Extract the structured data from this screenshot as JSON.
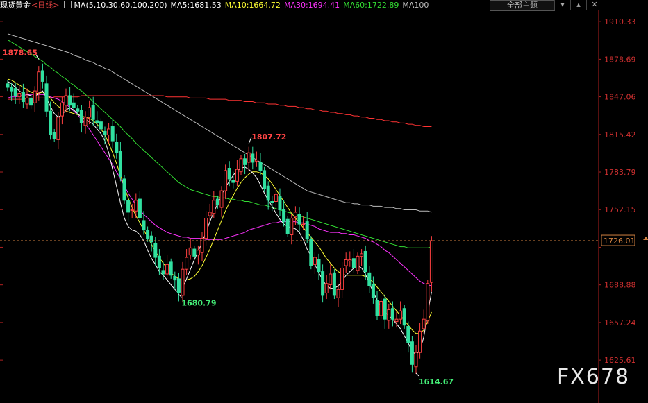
{
  "header": {
    "symbol": "现货黄金",
    "period": "<日线>",
    "ma_label": "MA(5,10,30,60,100,200)",
    "ma5": "MA5:1681.53",
    "ma10": "MA10:1664.72",
    "ma30": "MA30:1694.41",
    "ma60": "MA60:1722.89",
    "ma100": "MA100",
    "theme_button": "全部主题",
    "colors": {
      "ma5": "#ffffff",
      "ma10": "#ffff33",
      "ma30": "#ff33ff",
      "ma60": "#33dd33",
      "ma100": "#bbbbbb",
      "ma200": "#ff3333"
    }
  },
  "watermark": "FX678",
  "chart_data": {
    "type": "candlestick",
    "title": "",
    "ylim": [
      1600,
      1918
    ],
    "y_ticks": [
      1910.33,
      1878.69,
      1847.06,
      1815.42,
      1783.79,
      1752.15,
      1720.52,
      1688.88,
      1657.24,
      1625.61
    ],
    "y_tick_labels": [
      "1910.33",
      "1878.69",
      "1847.06",
      "1815.42",
      "1783.79",
      "1752.15",
      "",
      "1688.88",
      "1657.24",
      "1625.61"
    ],
    "current_price": 1726.01,
    "current_price_label": "1726.01",
    "annotations": [
      {
        "label": "1878.65",
        "value": 1878.65,
        "index": 8,
        "side": "left",
        "color": "#ff4444"
      },
      {
        "label": "1807.72",
        "value": 1807.72,
        "index": 62,
        "side": "right",
        "color": "#ff4444"
      },
      {
        "label": "1680.79",
        "value": 1680.79,
        "index": 44,
        "side": "right",
        "color": "#44ee77"
      },
      {
        "label": "1614.67",
        "value": 1614.67,
        "index": 105,
        "side": "right",
        "color": "#44ee77"
      }
    ],
    "up_color": "#ff4040",
    "down_color": "#30e0a0",
    "closes": [
      1855,
      1852,
      1848,
      1850,
      1843,
      1846,
      1840,
      1852,
      1868,
      1860,
      1835,
      1815,
      1812,
      1830,
      1842,
      1848,
      1840,
      1838,
      1835,
      1825,
      1830,
      1838,
      1828,
      1825,
      1820,
      1815,
      1820,
      1810,
      1800,
      1780,
      1760,
      1750,
      1752,
      1760,
      1745,
      1735,
      1728,
      1725,
      1712,
      1703,
      1698,
      1706,
      1697,
      1693,
      1682,
      1702,
      1712,
      1720,
      1713,
      1718,
      1728,
      1745,
      1750,
      1760,
      1756,
      1768,
      1785,
      1778,
      1775,
      1786,
      1795,
      1790,
      1800,
      1792,
      1794,
      1785,
      1770,
      1760,
      1758,
      1765,
      1752,
      1742,
      1732,
      1745,
      1750,
      1740,
      1740,
      1728,
      1705,
      1712,
      1700,
      1680,
      1690,
      1698,
      1680,
      1685,
      1703,
      1710,
      1710,
      1703,
      1713,
      1715,
      1700,
      1688,
      1678,
      1663,
      1675,
      1660,
      1668,
      1660,
      1660,
      1667,
      1655,
      1640,
      1622,
      1632,
      1650,
      1660,
      1690,
      1726
    ],
    "ma5": [
      1860,
      1858,
      1855,
      1852,
      1850,
      1849,
      1848,
      1847,
      1850,
      1852,
      1846,
      1839,
      1833,
      1830,
      1832,
      1836,
      1838,
      1836,
      1833,
      1830,
      1828,
      1826,
      1824,
      1820,
      1816,
      1810,
      1800,
      1786,
      1772,
      1758,
      1745,
      1738,
      1735,
      1734,
      1731,
      1726,
      1718,
      1711,
      1706,
      1700,
      1697,
      1693,
      1689,
      1685,
      1682,
      1686,
      1694,
      1702,
      1710,
      1717,
      1725,
      1733,
      1742,
      1750,
      1757,
      1764,
      1771,
      1776,
      1781,
      1785,
      1787,
      1788,
      1786,
      1783,
      1779,
      1773,
      1766,
      1760,
      1755,
      1749,
      1744,
      1740,
      1738,
      1737,
      1736,
      1733,
      1727,
      1719,
      1713,
      1706,
      1699,
      1693,
      1688,
      1686,
      1686,
      1688,
      1692,
      1697,
      1700,
      1703,
      1705,
      1703,
      1698,
      1690,
      1683,
      1676,
      1670,
      1666,
      1663,
      1660,
      1656,
      1652,
      1646,
      1640,
      1633,
      1630,
      1634,
      1645,
      1665,
      1683
    ],
    "ma10": [
      1862,
      1861,
      1859,
      1857,
      1855,
      1853,
      1851,
      1850,
      1850,
      1851,
      1849,
      1846,
      1842,
      1839,
      1837,
      1835,
      1834,
      1833,
      1832,
      1831,
      1830,
      1829,
      1827,
      1824,
      1820,
      1815,
      1808,
      1800,
      1791,
      1781,
      1771,
      1762,
      1754,
      1747,
      1741,
      1735,
      1729,
      1723,
      1717,
      1712,
      1707,
      1703,
      1699,
      1696,
      1694,
      1693,
      1693,
      1694,
      1696,
      1700,
      1705,
      1712,
      1719,
      1727,
      1735,
      1743,
      1751,
      1758,
      1764,
      1770,
      1775,
      1779,
      1782,
      1784,
      1784,
      1783,
      1781,
      1778,
      1774,
      1769,
      1764,
      1759,
      1754,
      1749,
      1745,
      1741,
      1737,
      1733,
      1729,
      1725,
      1721,
      1716,
      1711,
      1707,
      1703,
      1700,
      1698,
      1697,
      1697,
      1697,
      1697,
      1697,
      1696,
      1694,
      1691,
      1687,
      1683,
      1679,
      1675,
      1671,
      1667,
      1663,
      1659,
      1655,
      1651,
      1648,
      1648,
      1651,
      1658,
      1666
    ],
    "ma30": [
      1846,
      1847,
      1847,
      1848,
      1848,
      1849,
      1849,
      1849,
      1849,
      1849,
      1848,
      1847,
      1846,
      1845,
      1843,
      1841,
      1838,
      1835,
      1832,
      1828,
      1824,
      1820,
      1815,
      1810,
      1805,
      1800,
      1795,
      1790,
      1784,
      1778,
      1772,
      1766,
      1761,
      1756,
      1752,
      1748,
      1745,
      1742,
      1739,
      1737,
      1735,
      1733,
      1732,
      1731,
      1730,
      1729,
      1729,
      1728,
      1728,
      1728,
      1728,
      1727,
      1727,
      1727,
      1727,
      1727,
      1728,
      1729,
      1730,
      1731,
      1732,
      1733,
      1735,
      1736,
      1737,
      1738,
      1739,
      1740,
      1741,
      1741,
      1742,
      1742,
      1742,
      1742,
      1742,
      1741,
      1741,
      1740,
      1739,
      1738,
      1736,
      1735,
      1734,
      1733,
      1733,
      1733,
      1732,
      1732,
      1731,
      1731,
      1730,
      1729,
      1728,
      1726,
      1725,
      1723,
      1721,
      1718,
      1716,
      1713,
      1710,
      1707,
      1704,
      1701,
      1698,
      1695,
      1692,
      1690,
      1689,
      1688
    ],
    "ma60": [
      1895,
      1893,
      1891,
      1889,
      1887,
      1885,
      1883,
      1881,
      1879,
      1877,
      1874,
      1872,
      1869,
      1867,
      1864,
      1862,
      1859,
      1857,
      1854,
      1852,
      1849,
      1846,
      1843,
      1840,
      1837,
      1834,
      1831,
      1828,
      1825,
      1822,
      1818,
      1815,
      1812,
      1808,
      1805,
      1802,
      1799,
      1796,
      1793,
      1790,
      1787,
      1784,
      1781,
      1778,
      1775,
      1773,
      1771,
      1769,
      1768,
      1767,
      1766,
      1765,
      1764,
      1763,
      1763,
      1762,
      1762,
      1761,
      1761,
      1760,
      1760,
      1759,
      1759,
      1758,
      1757,
      1756,
      1756,
      1755,
      1754,
      1753,
      1752,
      1751,
      1750,
      1749,
      1748,
      1747,
      1746,
      1745,
      1744,
      1743,
      1742,
      1741,
      1740,
      1739,
      1738,
      1737,
      1736,
      1735,
      1734,
      1733,
      1732,
      1731,
      1730,
      1729,
      1728,
      1727,
      1726,
      1725,
      1724,
      1723,
      1722,
      1721,
      1721,
      1720,
      1720,
      1720,
      1720,
      1720,
      1720,
      1721
    ],
    "ma100": [
      1900,
      1899,
      1898,
      1897,
      1896,
      1895,
      1894,
      1893,
      1892,
      1891,
      1890,
      1889,
      1888,
      1887,
      1886,
      1885,
      1884,
      1882,
      1881,
      1880,
      1878,
      1877,
      1876,
      1874,
      1873,
      1871,
      1870,
      1868,
      1866,
      1864,
      1862,
      1860,
      1858,
      1856,
      1854,
      1852,
      1850,
      1848,
      1846,
      1844,
      1842,
      1840,
      1838,
      1836,
      1834,
      1832,
      1830,
      1828,
      1826,
      1824,
      1822,
      1820,
      1818,
      1816,
      1814,
      1812,
      1810,
      1808,
      1806,
      1804,
      1802,
      1800,
      1798,
      1796,
      1794,
      1792,
      1790,
      1788,
      1786,
      1784,
      1782,
      1780,
      1778,
      1776,
      1774,
      1772,
      1770,
      1768,
      1767,
      1766,
      1765,
      1764,
      1763,
      1762,
      1761,
      1760,
      1759,
      1758,
      1758,
      1757,
      1757,
      1756,
      1756,
      1756,
      1755,
      1755,
      1755,
      1754,
      1754,
      1754,
      1753,
      1753,
      1752,
      1752,
      1752,
      1752,
      1751,
      1751,
      1751,
      1750
    ],
    "ma200": [
      1845,
      1845,
      1845,
      1845,
      1845,
      1846,
      1846,
      1846,
      1846,
      1846,
      1846,
      1846,
      1847,
      1847,
      1847,
      1847,
      1847,
      1847,
      1847,
      1848,
      1848,
      1848,
      1848,
      1848,
      1848,
      1848,
      1848,
      1848,
      1848,
      1848,
      1848,
      1848,
      1848,
      1848,
      1848,
      1848,
      1848,
      1848,
      1848,
      1848,
      1848,
      1847,
      1847,
      1847,
      1847,
      1847,
      1847,
      1846,
      1846,
      1846,
      1846,
      1846,
      1845,
      1845,
      1845,
      1845,
      1845,
      1844,
      1844,
      1844,
      1844,
      1843,
      1843,
      1843,
      1842,
      1842,
      1842,
      1841,
      1841,
      1841,
      1840,
      1840,
      1839,
      1839,
      1839,
      1838,
      1838,
      1837,
      1837,
      1836,
      1836,
      1835,
      1835,
      1834,
      1834,
      1833,
      1833,
      1832,
      1832,
      1831,
      1831,
      1830,
      1830,
      1829,
      1829,
      1828,
      1828,
      1827,
      1827,
      1826,
      1826,
      1825,
      1825,
      1824,
      1824,
      1823,
      1823,
      1822,
      1822,
      1822
    ]
  }
}
